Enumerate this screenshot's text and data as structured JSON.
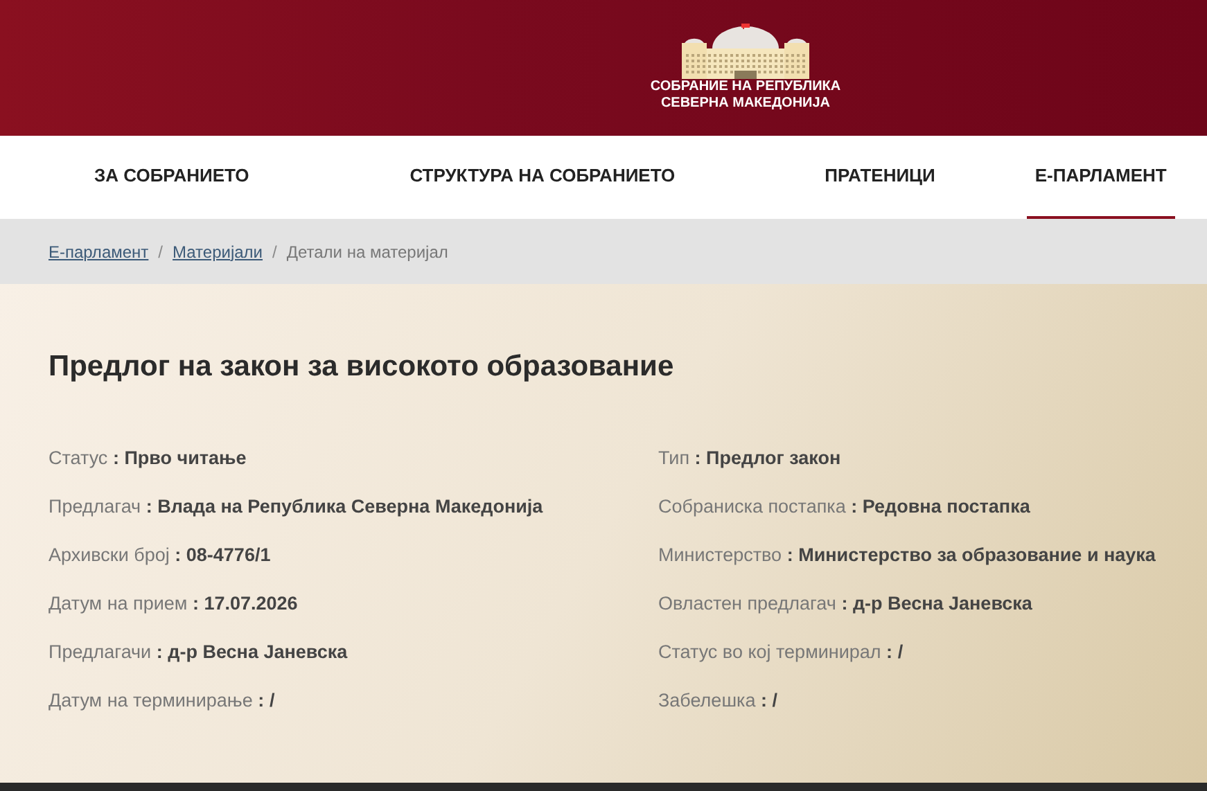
{
  "logo": {
    "lines": [
      "СОБРАНИЕ НА РЕПУБЛИКА",
      "СЕВЕРНА МАКЕДОНИЈА"
    ]
  },
  "nav": [
    {
      "label": "ЗА СОБРАНИЕТО",
      "selected": false
    },
    {
      "label": "СТРУКТУРА НА СОБРАНИЕТО",
      "selected": false
    },
    {
      "label": "ПРАТЕНИЦИ",
      "selected": false
    },
    {
      "label": "Е-ПАРЛАМЕНТ",
      "selected": true
    }
  ],
  "breadcrumb": [
    {
      "label": "Е-парламент",
      "kind": "link"
    },
    {
      "label": "Материјали",
      "kind": "link"
    },
    {
      "label": "Детали на материјал",
      "kind": "current"
    }
  ],
  "breadcrumb_separator": "/",
  "title": "Предлог на закон за високото образование",
  "field_separator": ":",
  "left_fields": [
    {
      "label": "Статус",
      "value": "Прво читање"
    },
    {
      "label": "Предлагач",
      "value": "Влада на Република Северна Македонија"
    },
    {
      "label": "Архивски број",
      "value": "08-4776/1"
    },
    {
      "label": "Датум на прием",
      "value": "17.07.2026"
    },
    {
      "label": "Предлагачи",
      "value": "д-р Весна Јаневска"
    },
    {
      "label": "Датум на терминирање",
      "value": "/"
    }
  ],
  "right_fields": [
    {
      "label": "Тип",
      "value": "Предлог закон"
    },
    {
      "label": "Собраниска постапка",
      "value": "Редовна постапка"
    },
    {
      "label": "Министерство",
      "value": "Министерство за образование и наука"
    },
    {
      "label": "Овластен предлагач",
      "value": "д-р Весна Јаневска"
    },
    {
      "label": "Статус во кој терминирал",
      "value": "/"
    },
    {
      "label": "Забелешка",
      "value": "/"
    }
  ]
}
